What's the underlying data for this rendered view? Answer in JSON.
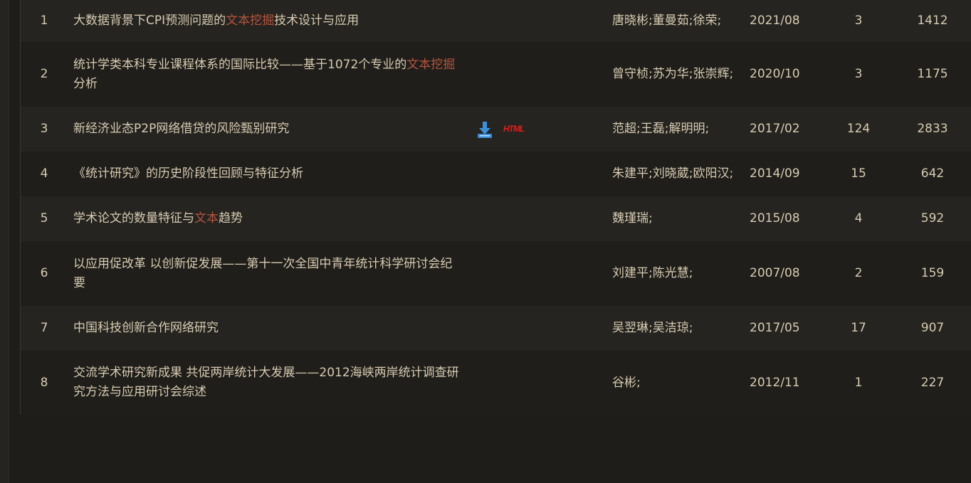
{
  "rows": [
    {
      "no": "1",
      "title": [
        {
          "t": "大数据背景下CPI预测问题的"
        },
        {
          "t": "文本挖掘",
          "hl": true
        },
        {
          "t": "技术设计与应用"
        }
      ],
      "authors": "唐晓彬;董曼茹;徐荣;",
      "date": "2021/08",
      "cited": "3",
      "downloads": "1412",
      "h": 59
    },
    {
      "no": "2",
      "title": [
        {
          "t": "统计学类本科专业课程体系的国际比较——基于1072个专业的"
        },
        {
          "t": "文本挖掘",
          "hl": true
        },
        {
          "t": "分析"
        }
      ],
      "authors": "曾守桢;苏为华;张崇辉;",
      "date": "2020/10",
      "cited": "3",
      "downloads": "1175",
      "h": 91
    },
    {
      "no": "3",
      "title": [
        {
          "t": "新经济业态P2P网络借贷的风险甄别研究"
        }
      ],
      "authors": "范超;王磊;解明明;",
      "date": "2017/02",
      "cited": "124",
      "downloads": "2833",
      "h": 63,
      "icons": {
        "download": "download-icon",
        "html": "HTML"
      }
    },
    {
      "no": "4",
      "title": [
        {
          "t": "《统计研究》的历史阶段性回顾与特征分析"
        }
      ],
      "authors": "朱建平;刘晓葳;欧阳汉;",
      "date": "2014/09",
      "cited": "15",
      "downloads": "642",
      "h": 63
    },
    {
      "no": "5",
      "title": [
        {
          "t": "学术论文的数量特征与"
        },
        {
          "t": "文本",
          "hl": true
        },
        {
          "t": "趋势"
        }
      ],
      "authors": "魏瑾瑞;",
      "date": "2015/08",
      "cited": "4",
      "downloads": "592",
      "h": 63
    },
    {
      "no": "6",
      "title": [
        {
          "t": "以应用促改革 以创新促发展——第十一次全国中青年统计科学研讨会纪要"
        }
      ],
      "authors": "刘建平;陈光慧;",
      "date": "2007/08",
      "cited": "2",
      "downloads": "159",
      "h": 91
    },
    {
      "no": "7",
      "title": [
        {
          "t": "中国科技创新合作网络研究"
        }
      ],
      "authors": "吴翌琳;吴洁琼;",
      "date": "2017/05",
      "cited": "17",
      "downloads": "907",
      "h": 63
    },
    {
      "no": "8",
      "title": [
        {
          "t": "交流学术研究新成果 共促两岸统计大发展——2012海峡两岸统计调查研究方法与应用研讨会综述"
        }
      ],
      "authors": "谷彬;",
      "date": "2012/11",
      "cited": "1",
      "downloads": "227",
      "h": 90
    }
  ],
  "colors": {
    "highlight": "#b7543e",
    "text": "#d8cbb2",
    "html_icon": "#e31d1d",
    "download_icon": "#3c8fd9"
  }
}
